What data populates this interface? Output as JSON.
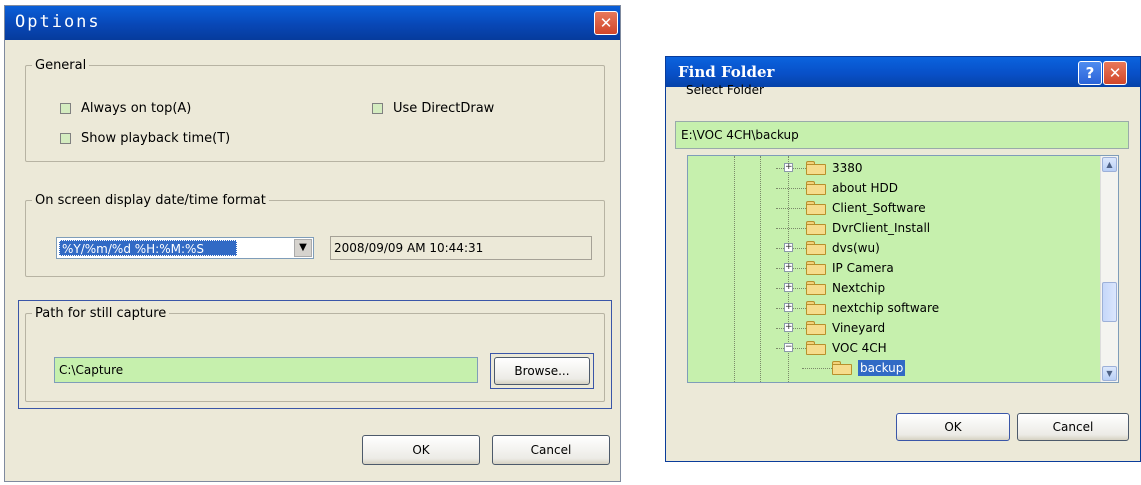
{
  "options": {
    "title": "Options",
    "general": {
      "legend": "General",
      "always_on_top": {
        "label": "Always on top ",
        "mnemonic": "(A)"
      },
      "use_directdraw": {
        "label": "Use DirectDraw"
      },
      "show_playback": {
        "label": "Show playback time ",
        "mnemonic": "(T)"
      }
    },
    "osd": {
      "legend": "On screen display date/time format",
      "format_value": "%Y/%m/%d %H:%M:%S",
      "preview": "2008/09/09 AM 10:44:31"
    },
    "capture": {
      "legend": "Path for still capture",
      "path_value": "C:\\Capture",
      "browse_label": "Browse..."
    },
    "ok_label": "OK",
    "cancel_label": "Cancel"
  },
  "find_folder": {
    "title": "Find Folder",
    "help_label": "?",
    "select_label": "Select Folder",
    "path_value": "E:\\VOC 4CH\\backup",
    "tree": [
      {
        "label": "3380",
        "expander": "+"
      },
      {
        "label": "about HDD",
        "expander": ""
      },
      {
        "label": "Client_Software",
        "expander": ""
      },
      {
        "label": "DvrClient_Install",
        "expander": ""
      },
      {
        "label": "dvs(wu)",
        "expander": "+"
      },
      {
        "label": "IP Camera",
        "expander": "+"
      },
      {
        "label": "Nextchip",
        "expander": "+"
      },
      {
        "label": "nextchip software",
        "expander": "+"
      },
      {
        "label": "Vineyard",
        "expander": "+"
      },
      {
        "label": "VOC 4CH",
        "expander": "−"
      },
      {
        "label": "backup",
        "expander": "",
        "selected": true
      }
    ],
    "ok_label": "OK",
    "cancel_label": "Cancel"
  },
  "colors": {
    "field_green": "#c6f0ad",
    "dialog_bg": "#ece9d8",
    "title_blue": "#0a5fd8",
    "selection_blue": "#316ac5"
  }
}
